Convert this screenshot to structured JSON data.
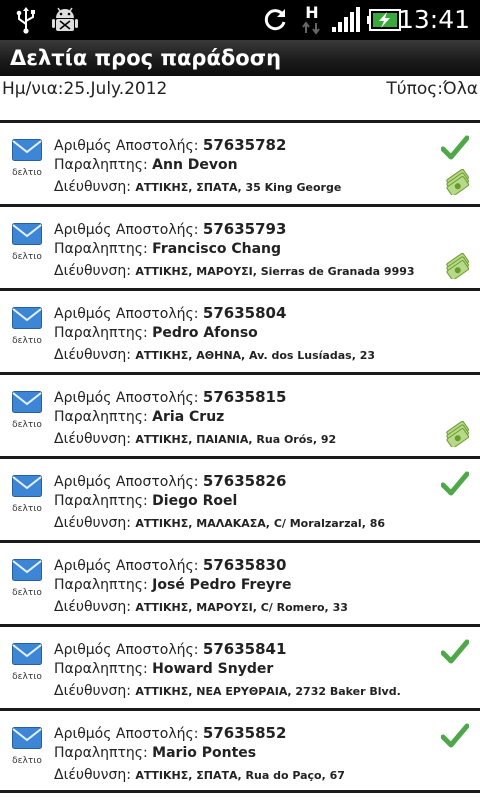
{
  "status_bar": {
    "time": "13:41",
    "network_letter": "H",
    "icons": [
      "usb-icon",
      "android-debug-icon",
      "sync-icon",
      "network-h-icon",
      "signal-icon",
      "battery-charging-icon"
    ]
  },
  "title_bar": {
    "title": "Δελτία προς παράδοση"
  },
  "filter": {
    "date_text": "Ημ/νια:25.July.2012",
    "type_text": "Τύπος:Όλα"
  },
  "labels": {
    "shipment": "Αριθμός Αποστολής:",
    "recipient": "Παραληπτης:",
    "address": "Διέυθυνση:",
    "envelope": "δελτιο"
  },
  "colors": {
    "check": "#4ea84a",
    "envelope": "#3d86d6",
    "money": "#6a9a2c"
  },
  "deliveries": [
    {
      "shipment_no": "57635782",
      "recipient": "Ann Devon",
      "address": "ΑΤΤΙΚΗΣ, ΣΠΑΤΑ, 35 King George",
      "check": true,
      "money": true
    },
    {
      "shipment_no": "57635793",
      "recipient": "Francisco Chang",
      "address": "ΑΤΤΙΚΗΣ, ΜΑΡΟΥΣΙ, Sierras de Granada 9993",
      "check": false,
      "money": true
    },
    {
      "shipment_no": "57635804",
      "recipient": "Pedro Afonso",
      "address": "ΑΤΤΙΚΗΣ, ΑΘΗΝΑ, Av. dos Lusíadas, 23",
      "check": false,
      "money": false
    },
    {
      "shipment_no": "57635815",
      "recipient": "Aria Cruz",
      "address": "ΑΤΤΙΚΗΣ, ΠΑΙΑΝΙΑ, Rua Orós, 92",
      "check": false,
      "money": true
    },
    {
      "shipment_no": "57635826",
      "recipient": "Diego Roel",
      "address": "ΑΤΤΙΚΗΣ, ΜΑΛΑΚΑΣΑ, C/ Moralzarzal, 86",
      "check": true,
      "money": false
    },
    {
      "shipment_no": "57635830",
      "recipient": "José Pedro Freyre",
      "address": "ΑΤΤΙΚΗΣ, ΜΑΡΟΥΣΙ, C/ Romero, 33",
      "check": false,
      "money": false
    },
    {
      "shipment_no": "57635841",
      "recipient": "Howard Snyder",
      "address": "ΑΤΤΙΚΗΣ, ΝΕΑ ΕΡΥΘΡΑΙΑ, 2732 Baker Blvd.",
      "check": true,
      "money": false
    },
    {
      "shipment_no": "57635852",
      "recipient": "Mario Pontes",
      "address": "ΑΤΤΙΚΗΣ, ΣΠΑΤΑ, Rua do Paço, 67",
      "check": true,
      "money": false
    }
  ]
}
